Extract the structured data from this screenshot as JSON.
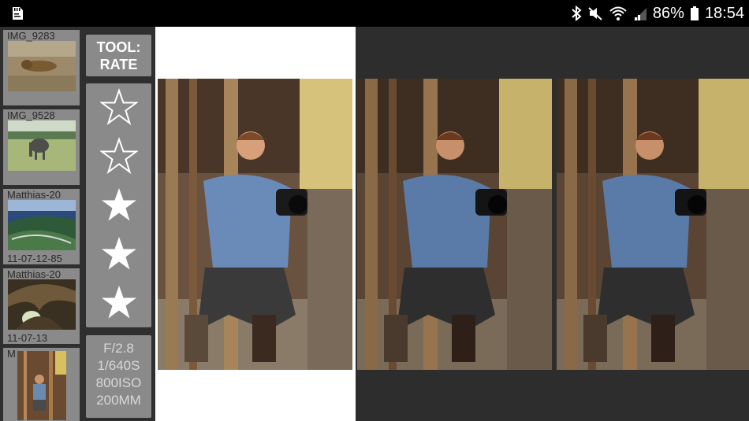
{
  "status_bar": {
    "battery_percent": "86%",
    "time": "18:54",
    "icons": [
      "sd-card-icon",
      "bluetooth-icon",
      "mute-icon",
      "wifi-icon",
      "signal-icon",
      "battery-icon"
    ]
  },
  "thumbnails": [
    {
      "label": "IMG_9283",
      "sublabel": ""
    },
    {
      "label": "IMG_9528",
      "sublabel": ""
    },
    {
      "label": "Matthias-20",
      "sublabel": "11-07-12-85"
    },
    {
      "label": "Matthias-20",
      "sublabel": "11-07-13"
    },
    {
      "label": "M",
      "sublabel": ""
    }
  ],
  "tool": {
    "line1": "TOOL:",
    "line2": "RATE"
  },
  "rating": {
    "value": 3,
    "max": 5
  },
  "exif": {
    "aperture": "F/2.8",
    "shutter": "1/640S",
    "iso": "800ISO",
    "focal": "200MM"
  },
  "colors": {
    "panel_bg": "#2f2f2f",
    "button_bg": "#8a8a8a",
    "viewer_dark": "#2d2d2d"
  }
}
